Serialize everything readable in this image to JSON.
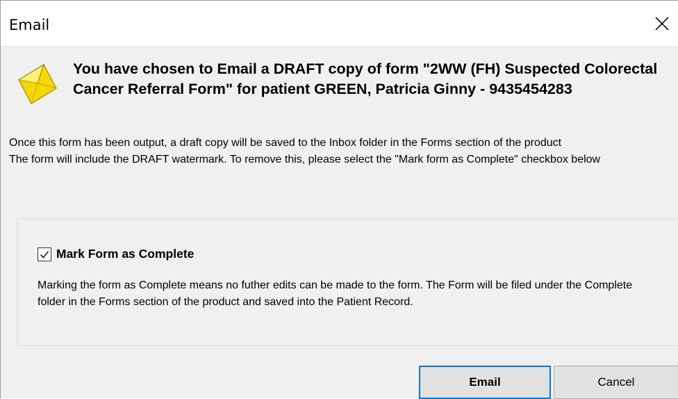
{
  "window": {
    "title": "Email"
  },
  "header": {
    "icon": "envelope-icon",
    "text": "You have chosen to Email a DRAFT copy of form \"2WW (FH) Suspected Colorectal Cancer Referral Form\" for patient GREEN, Patricia Ginny - 9435454283"
  },
  "info": {
    "line1": "Once this form has been output, a draft copy will be saved to the Inbox folder in the Forms section of the product",
    "line2": "The form will include the DRAFT watermark. To remove this, please select the \"Mark form as Complete\" checkbox below"
  },
  "complete": {
    "label": "Mark Form as Complete",
    "checked": true,
    "description": "Marking the form as Complete means no futher edits can be made to the form. The Form will be filed under the Complete folder in the Forms section of the product and saved into the Patient Record."
  },
  "buttons": {
    "email": "Email",
    "cancel": "Cancel"
  },
  "colors": {
    "default_button_border": "#0078d7",
    "dialog_background": "#f0f0f0",
    "icon_yellow": "#f5d800"
  }
}
